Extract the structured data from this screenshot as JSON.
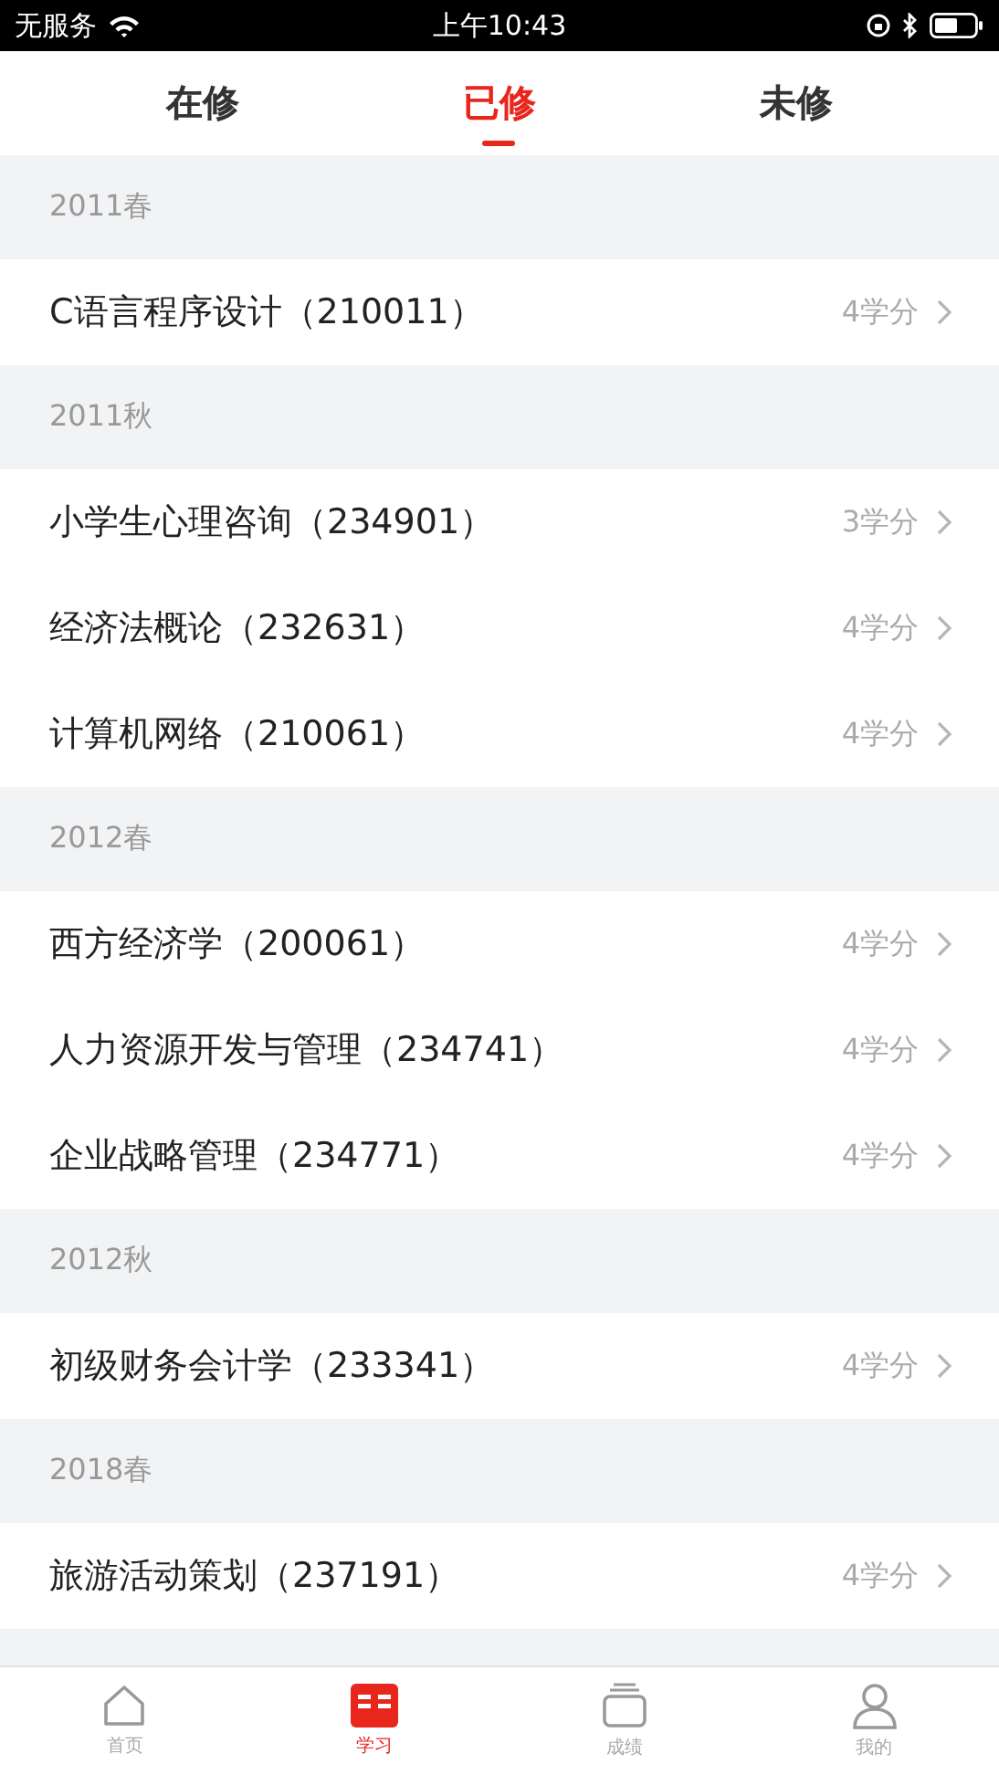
{
  "status_bar": {
    "carrier": "无服务",
    "time": "上午10:43"
  },
  "tabs": [
    {
      "label": "在修",
      "selected": false
    },
    {
      "label": "已修",
      "selected": true
    },
    {
      "label": "未修",
      "selected": false
    }
  ],
  "sections": [
    {
      "term": "2011春",
      "courses": [
        {
          "name": "C语言程序设计",
          "code": "（210011）",
          "credits": "4学分"
        }
      ]
    },
    {
      "term": "2011秋",
      "courses": [
        {
          "name": "小学生心理咨询",
          "code": "（234901）",
          "credits": "3学分"
        },
        {
          "name": "经济法概论",
          "code": "（232631）",
          "credits": "4学分"
        },
        {
          "name": "计算机网络",
          "code": "（210061）",
          "credits": "4学分"
        }
      ]
    },
    {
      "term": "2012春",
      "courses": [
        {
          "name": "西方经济学",
          "code": "（200061）",
          "credits": "4学分"
        },
        {
          "name": "人力资源开发与管理",
          "code": "（234741）",
          "credits": "4学分"
        },
        {
          "name": "企业战略管理",
          "code": "（234771）",
          "credits": "4学分"
        }
      ]
    },
    {
      "term": "2012秋",
      "courses": [
        {
          "name": "初级财务会计学",
          "code": "（233341）",
          "credits": "4学分"
        }
      ]
    },
    {
      "term": "2018春",
      "courses": [
        {
          "name": "旅游活动策划",
          "code": "（237191）",
          "credits": "4学分"
        }
      ]
    }
  ],
  "bottom_nav": [
    {
      "label": "首页",
      "kind": "home",
      "selected": false
    },
    {
      "label": "学习",
      "kind": "study",
      "selected": true
    },
    {
      "label": "成绩",
      "kind": "grades",
      "selected": false
    },
    {
      "label": "我的",
      "kind": "profile",
      "selected": false
    }
  ]
}
